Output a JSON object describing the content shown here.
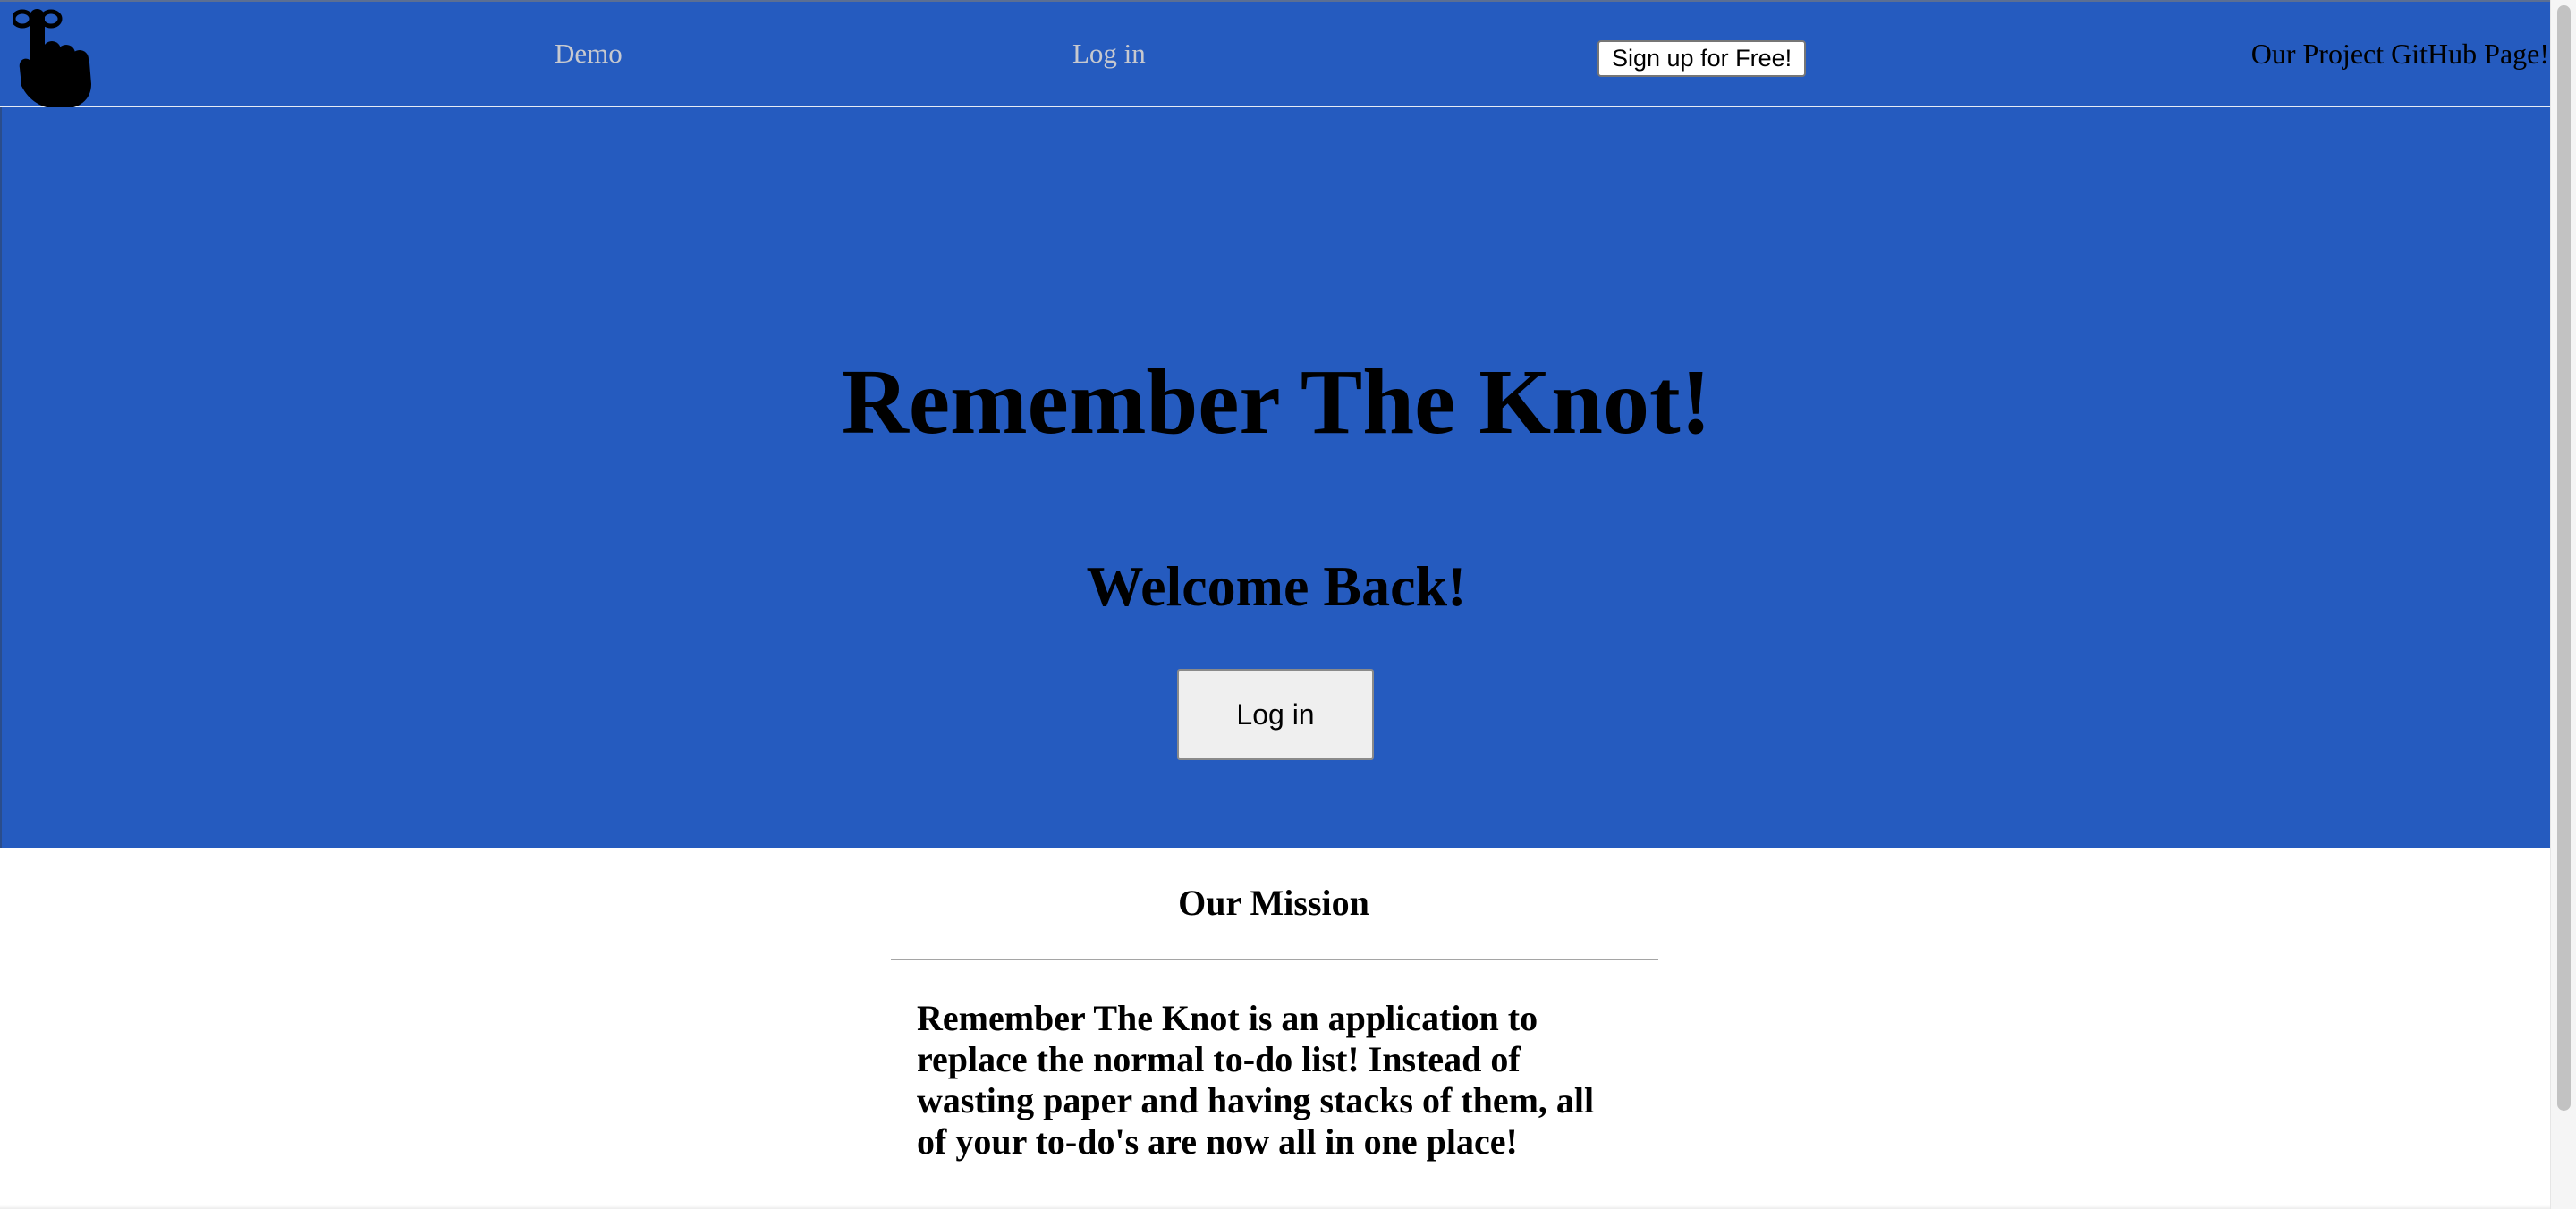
{
  "nav": {
    "logo_icon": "tied-finger-hand-icon",
    "demo_label": "Demo",
    "login_label": "Log in",
    "signup_label": "Sign up for Free!",
    "github_label": "Our Project GitHub Page!"
  },
  "hero": {
    "title": "Remember The Knot!",
    "subtitle": "Welcome Back!",
    "login_button_label": "Log in"
  },
  "mission": {
    "heading": "Our Mission",
    "text": "Remember The Knot is an application to replace the normal to-do list! Instead of wasting paper and having stacks of them, all of your to-do's are now all in one place!"
  },
  "colors": {
    "brand_blue": "#255bbf",
    "nav_link_gray": "#c7c9cf",
    "text": "#000000",
    "page_background": "#ffffff"
  }
}
